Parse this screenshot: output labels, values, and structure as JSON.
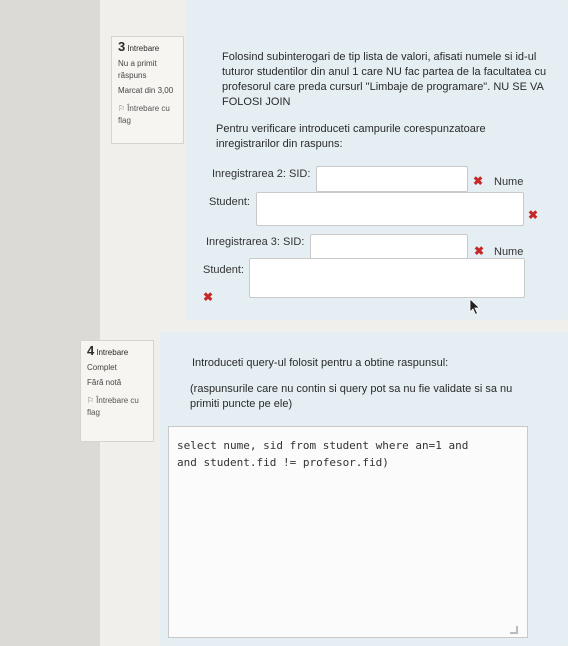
{
  "q3": {
    "number": "3",
    "word": "Intrebare",
    "status": "Nu a primit răspuns",
    "mark": "Marcat din 3,00",
    "flag": "Întrebare cu flag",
    "text": "Folosind subinterogari de tip lista de valori, afisati numele si id-ul tuturor studentilor din anul 1 care NU fac partea de la facultatea cu profesorul care preda cursurl \"Limbaje de programare\". NU SE VA FOLOSI JOIN",
    "instruction": "Pentru verificare introduceti campurile corespunzatoare inregistrarilor din raspuns:",
    "rec2_label": "Inregistrarea 2: SID:",
    "rec3_label": "Inregistrarea 3: SID:",
    "nume_label": "Nume",
    "student_label": "Student:"
  },
  "q4": {
    "number": "4",
    "word": "Intrebare",
    "status": "Complet",
    "mark": "Fără notă",
    "flag": "Întrebare cu flag",
    "text": "Introduceti query-ul folosit pentru a obtine raspunsul:",
    "note": "(raspunsurile care nu contin si query pot sa nu fie validate si sa nu primiti puncte pe ele)",
    "answer": "select nume, sid from student where an=1 and\nand student.fid != profesor.fid)"
  }
}
